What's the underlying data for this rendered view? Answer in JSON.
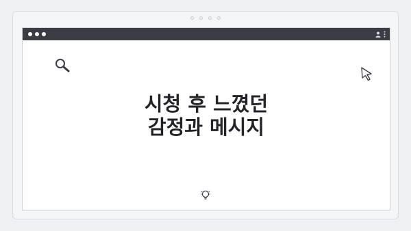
{
  "window": {
    "titlebar": {
      "traffic_lights": [
        "dot",
        "dot",
        "dot"
      ],
      "right_icons": [
        "user-icon",
        "more-vertical-icon"
      ]
    },
    "icons": {
      "top_left": "search-icon",
      "top_right": "cursor-icon",
      "bottom_center": "lightbulb-icon"
    }
  },
  "headline": {
    "line1": "시청 후 느꼈던",
    "line2": "감정과 메시지"
  },
  "colors": {
    "background": "#eef0f3",
    "titlebar": "#3a3d44",
    "window": "#ffffff",
    "text": "#222428"
  }
}
